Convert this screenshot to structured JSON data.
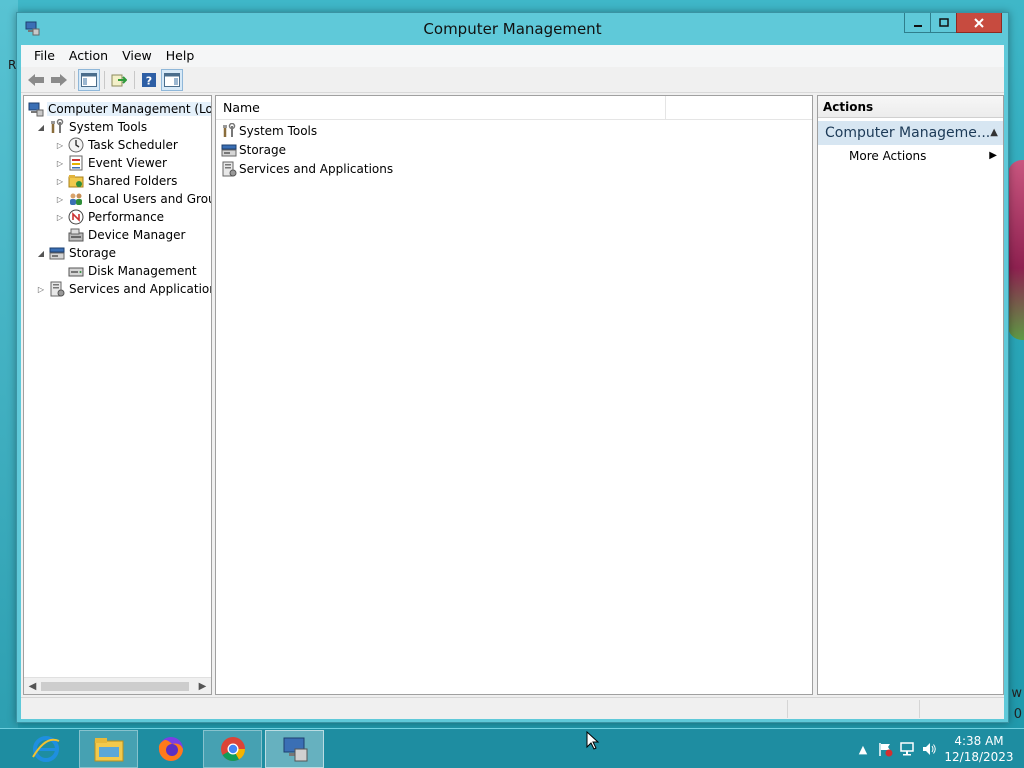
{
  "window": {
    "title": "Computer Management"
  },
  "menu": [
    "File",
    "Action",
    "View",
    "Help"
  ],
  "tree": {
    "items": [
      {
        "label": "Computer Management (Local",
        "level": 0,
        "expander": "",
        "icon": "computer-management-icon",
        "selected": true
      },
      {
        "label": "System Tools",
        "level": 1,
        "expander": "expanded",
        "icon": "tools-icon"
      },
      {
        "label": "Task Scheduler",
        "level": 2,
        "expander": "collapsed",
        "icon": "clock-icon"
      },
      {
        "label": "Event Viewer",
        "level": 2,
        "expander": "collapsed",
        "icon": "event-viewer-icon"
      },
      {
        "label": "Shared Folders",
        "level": 2,
        "expander": "collapsed",
        "icon": "shared-folder-icon"
      },
      {
        "label": "Local Users and Groups",
        "level": 2,
        "expander": "collapsed",
        "icon": "users-icon"
      },
      {
        "label": "Performance",
        "level": 2,
        "expander": "collapsed",
        "icon": "performance-icon"
      },
      {
        "label": "Device Manager",
        "level": 2,
        "expander": "",
        "icon": "device-manager-icon"
      },
      {
        "label": "Storage",
        "level": 1,
        "expander": "expanded",
        "icon": "storage-icon"
      },
      {
        "label": "Disk Management",
        "level": 2,
        "expander": "",
        "icon": "disk-icon"
      },
      {
        "label": "Services and Applications",
        "level": 1,
        "expander": "collapsed",
        "icon": "services-icon"
      }
    ]
  },
  "list": {
    "column_name": "Name",
    "rows": [
      {
        "label": "System Tools",
        "icon": "tools-icon"
      },
      {
        "label": "Storage",
        "icon": "storage-icon"
      },
      {
        "label": "Services and Applications",
        "icon": "services-icon"
      }
    ]
  },
  "actions": {
    "header": "Actions",
    "section": "Computer Manageme...",
    "items": [
      "More Actions"
    ]
  },
  "taskbar": {
    "apps": [
      "internet-explorer-icon",
      "file-explorer-icon",
      "firefox-icon",
      "chrome-icon",
      "computer-management-icon"
    ],
    "time": "4:38 AM",
    "date": "12/18/2023"
  },
  "desktop": {
    "left_letter": "R",
    "right_letters": [
      "w",
      "0"
    ]
  },
  "colors": {
    "titlebar": "#5fc9d9",
    "close_button": "#c74b3f",
    "selection": "#e5f1fb",
    "actions_section": "#d7e6f2"
  }
}
